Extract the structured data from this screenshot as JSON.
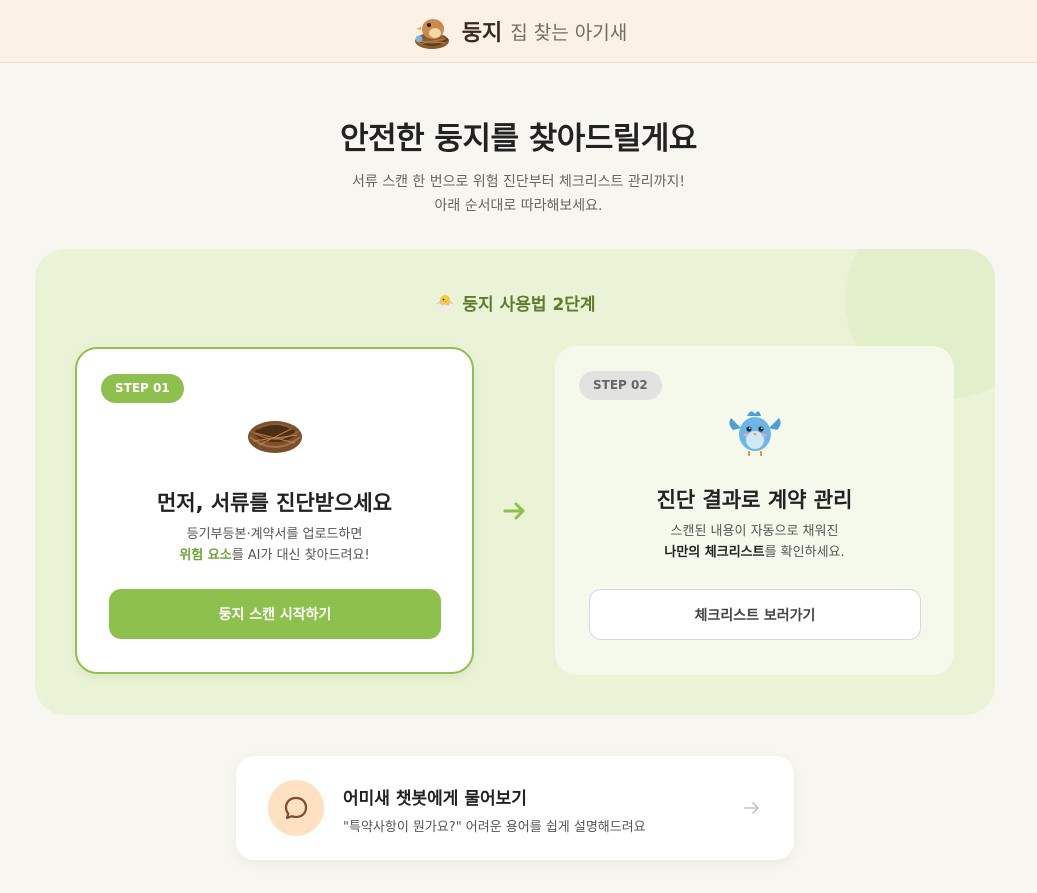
{
  "header": {
    "brand_name": "둥지",
    "tagline": "집 찾는 아기새"
  },
  "hero": {
    "title": "안전한 둥지를 찾아드릴게요",
    "subtitle_line1": "서류 스캔 한 번으로 위험 진단부터 체크리스트 관리까지!",
    "subtitle_line2": "아래 순서대로 따라해보세요."
  },
  "guide": {
    "title": "둥지 사용법 2단계",
    "steps": [
      {
        "badge": "STEP 01",
        "title": "먼저, 서류를 진단받으세요",
        "desc_line1": "등기부등본·계약서를 업로드하면",
        "desc_highlight": "위험 요소",
        "desc_line2_rest": "를 AI가 대신 찾아드려요!",
        "button": "둥지 스캔 시작하기",
        "illustration": "nest-icon"
      },
      {
        "badge": "STEP 02",
        "title": "진단 결과로 계약 관리",
        "desc_line1": "스캔된 내용이 자동으로 채워진",
        "desc_highlight": "나만의 체크리스트",
        "desc_line2_rest": "를 확인하세요.",
        "button": "체크리스트 보러가기",
        "illustration": "bluebird-icon"
      }
    ]
  },
  "chatbot": {
    "title": "어미새 챗봇에게 물어보기",
    "description": "\"특약사항이 뭔가요?\" 어려운 용어를 쉽게 설명해드려요"
  },
  "colors": {
    "accent_green": "#8ec04e",
    "panel_bg": "#ebf3d6",
    "header_bg": "#fbf1e6",
    "chat_icon_bg": "#fde1c2"
  }
}
